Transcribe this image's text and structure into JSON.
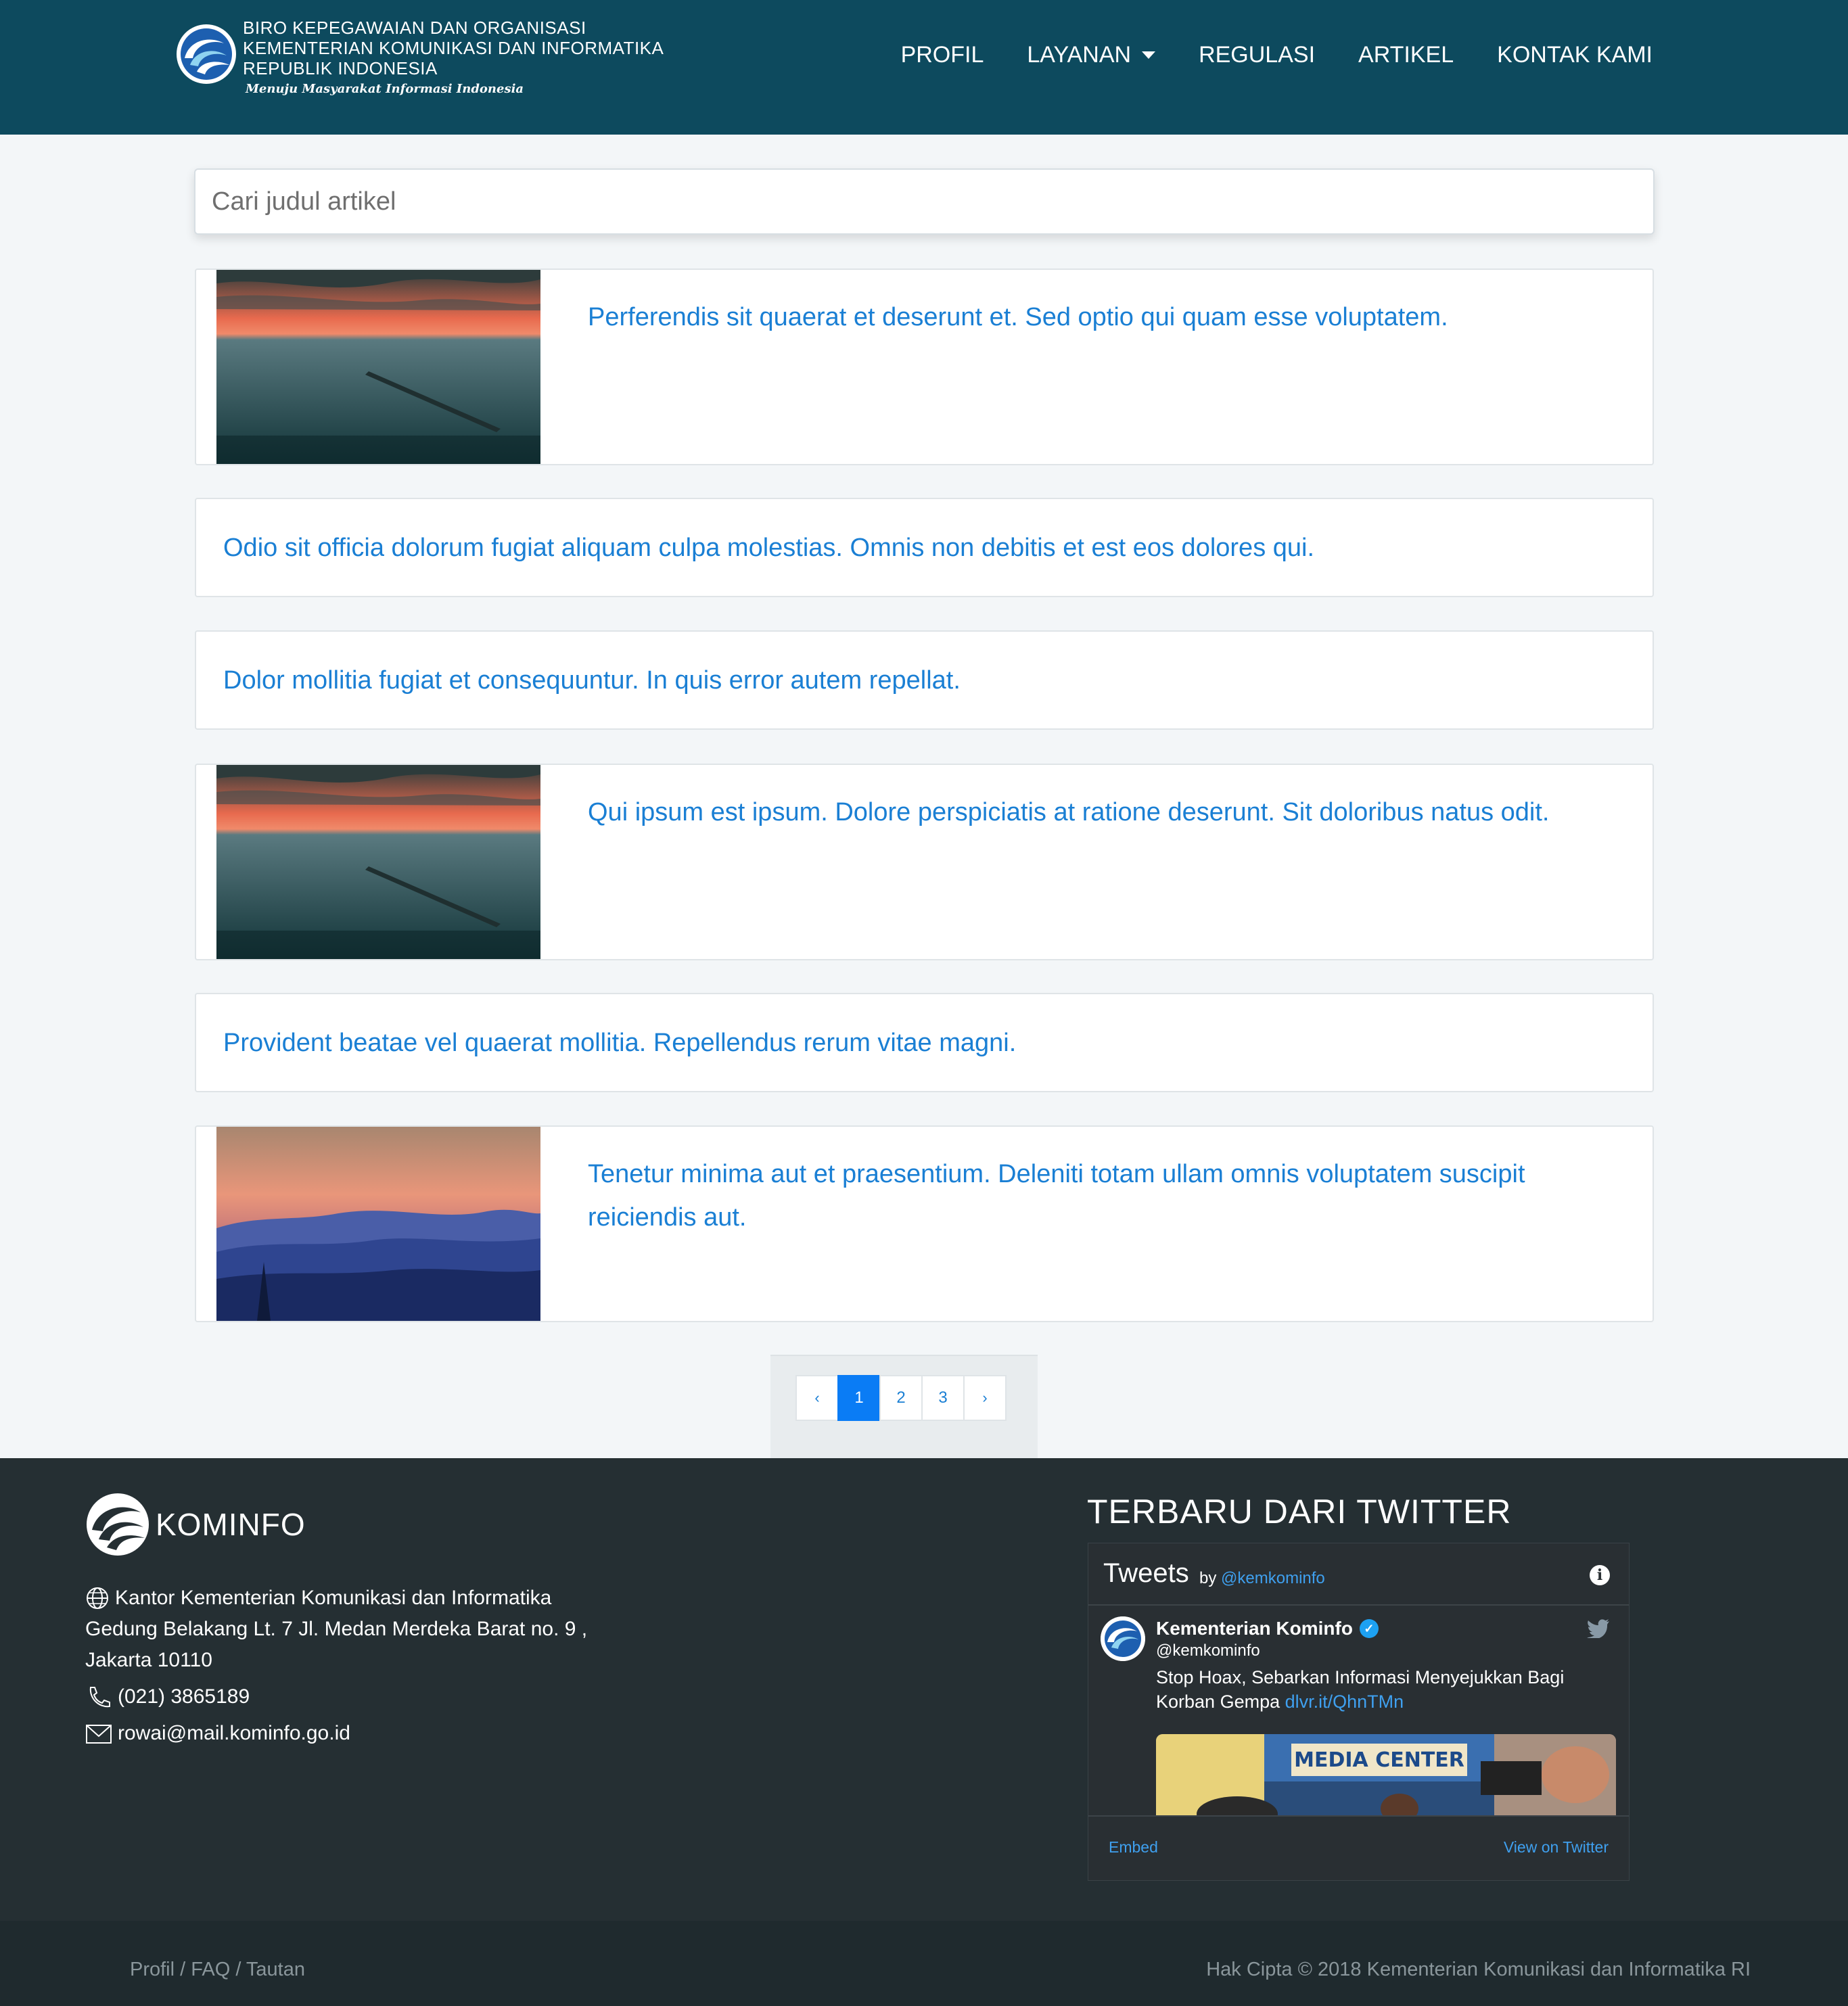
{
  "header": {
    "brand_lines": [
      "BIRO KEPEGAWAIAN DAN ORGANISASI",
      "KEMENTERIAN KOMUNIKASI DAN INFORMATIKA",
      "REPUBLIK INDONESIA"
    ],
    "brand_tagline": "Menuju Masyarakat Informasi Indonesia",
    "nav": [
      "PROFIL",
      "LAYANAN",
      "REGULASI",
      "ARTIKEL",
      "KONTAK KAMI"
    ],
    "background": "#0d4a5e"
  },
  "search": {
    "placeholder": "Cari judul artikel",
    "value": ""
  },
  "articles": [
    {
      "title": "Perferendis sit quaerat et deserunt et. Sed optio qui quam esse voluptatem.",
      "image": "sunset-pier"
    },
    {
      "title": "Odio sit officia dolorum fugiat aliquam culpa molestias. Omnis non debitis et est eos dolores qui."
    },
    {
      "title": "Dolor mollitia fugiat et consequuntur. In quis error autem repellat."
    },
    {
      "title": "Qui ipsum est ipsum. Dolore perspiciatis at ratione deserunt. Sit doloribus natus odit.",
      "image": "sunset-pier"
    },
    {
      "title": "Provident beatae vel quaerat mollitia. Repellendus rerum vitae magni."
    },
    {
      "title": "Tenetur minima aut et praesentium. Deleniti totam ullam omnis voluptatem suscipit reiciendis aut.",
      "image": "mountain-sunset"
    }
  ],
  "pagination": {
    "prev": "‹",
    "pages": [
      "1",
      "2",
      "3"
    ],
    "next": "›",
    "current": "1"
  },
  "footer": {
    "logo_text": "KOMINFO",
    "address_lines": [
      "Kantor Kementerian Komunikasi dan Informatika",
      "Gedung Belakang Lt. 7 Jl. Medan Merdeka Barat no. 9 ,",
      "Jakarta 10110"
    ],
    "phone": "(021) 3865189",
    "email": "rowai@mail.kominfo.go.id",
    "twitter_heading": "TERBARU DARI TWITTER",
    "twitter": {
      "title": "Tweets",
      "by": "by",
      "handle_link": "@kemkominfo",
      "info": "i",
      "account_name": "Kementerian Kominfo",
      "verified": "✓",
      "account_handle": "@kemkominfo",
      "tweet_text": "Stop Hoax, Sebarkan Informasi Menyejukkan Bagi Korban Gempa",
      "tweet_link": "dlvr.it/QhnTMn",
      "media_caption": "MEDIA CENTER",
      "embed": "Embed",
      "view": "View on Twitter"
    },
    "bottom_left": "Profil / FAQ / Tautan",
    "bottom_right": "Hak Cipta © 2018 Kementerian Komunikasi dan Informatika RI"
  },
  "colors": {
    "link": "#1a7fd4",
    "active_page": "#0a7cf5",
    "footer": "#252f33"
  }
}
